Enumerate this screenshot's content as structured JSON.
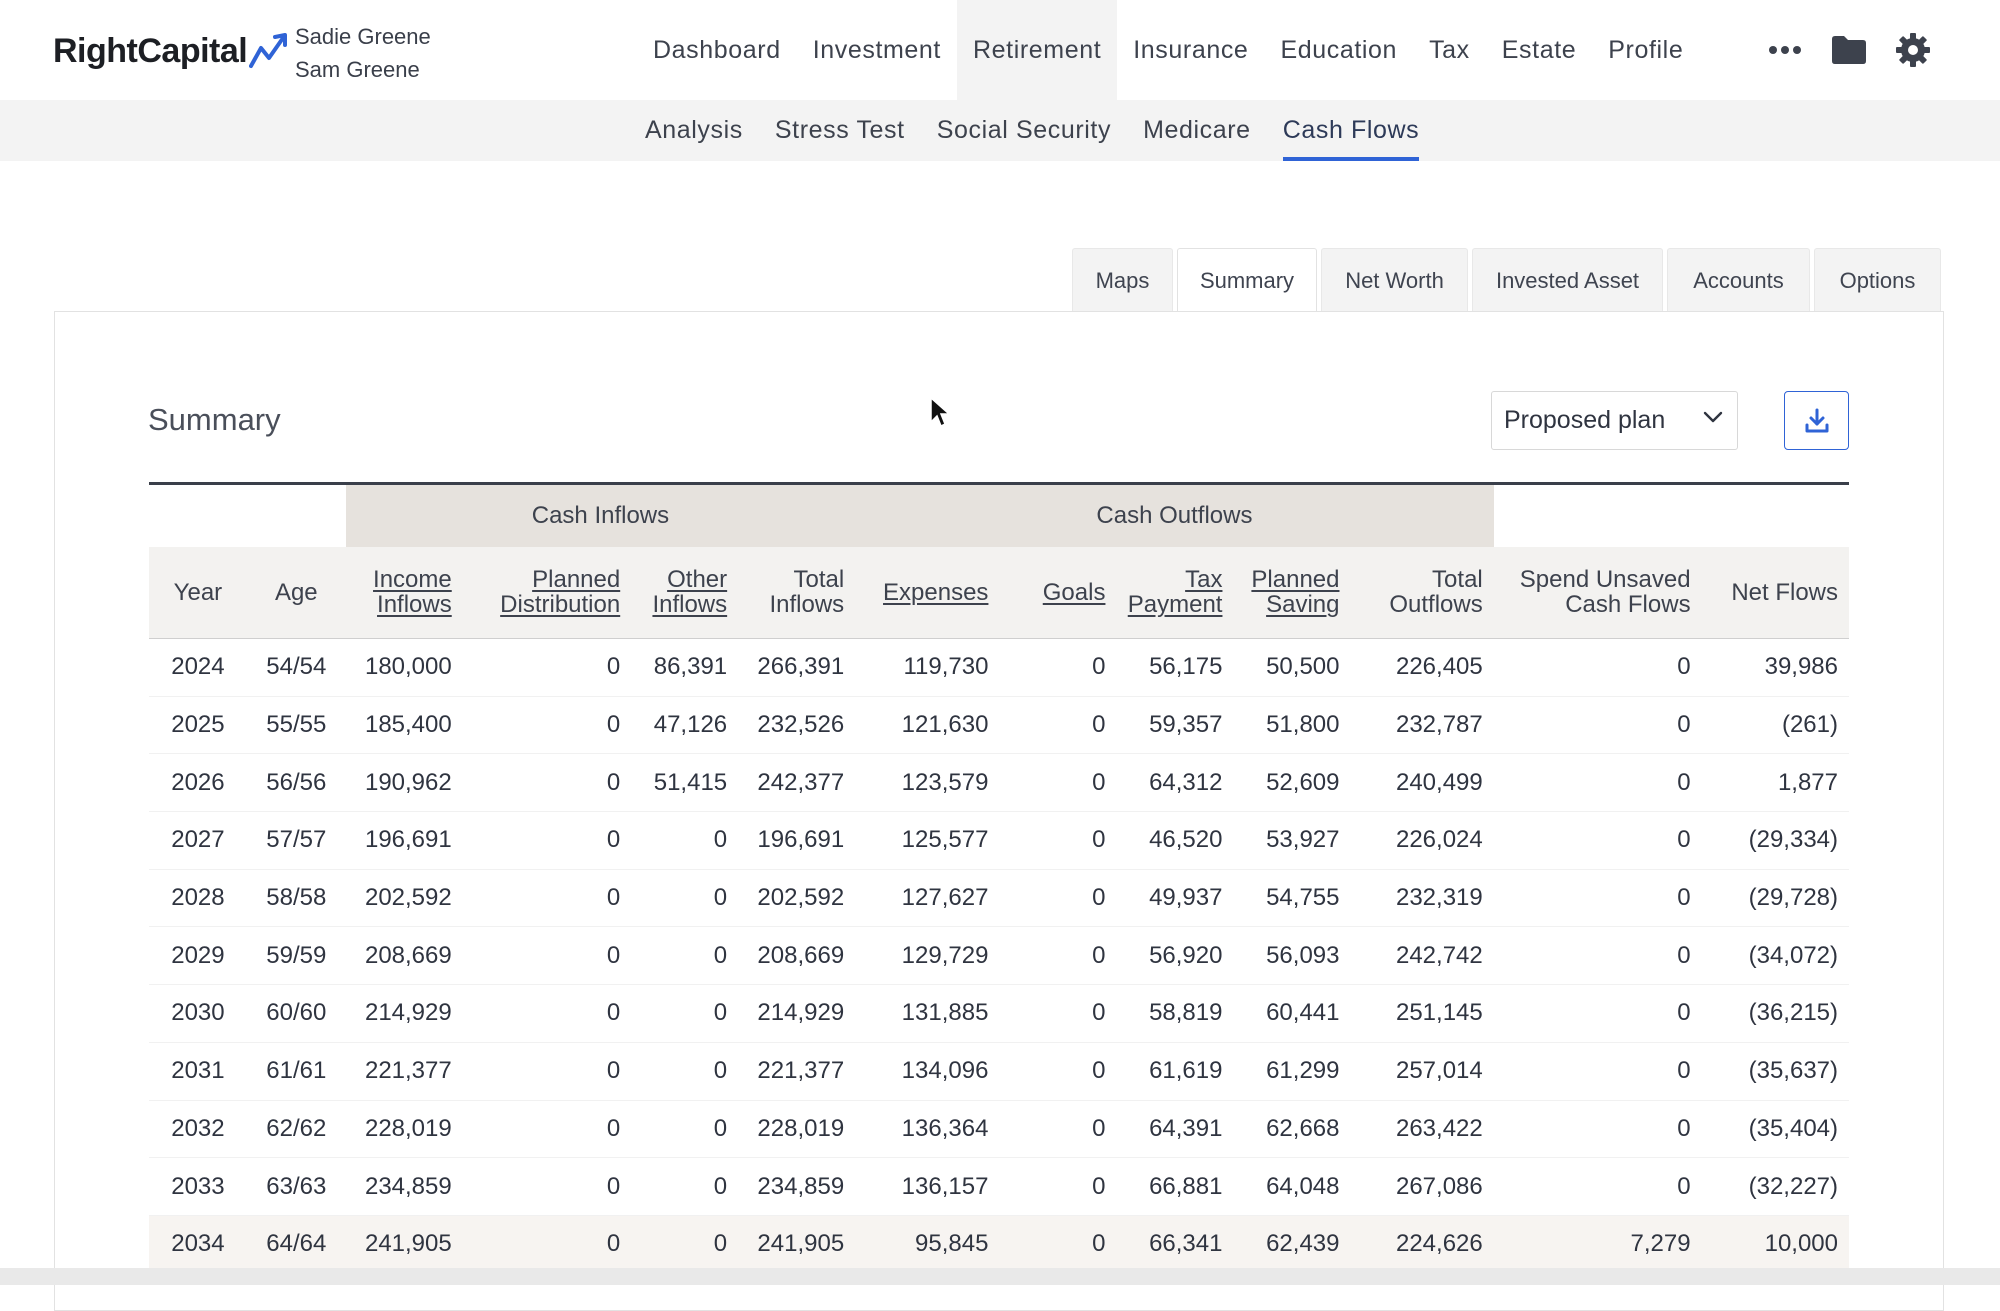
{
  "brand": {
    "name": "RightCapital",
    "accent": "#2f63d6"
  },
  "clients": [
    "Sadie Greene",
    "Sam Greene"
  ],
  "main_nav": [
    "Dashboard",
    "Investment",
    "Retirement",
    "Insurance",
    "Education",
    "Tax",
    "Estate",
    "Profile"
  ],
  "main_nav_active": "Retirement",
  "icons": {
    "more": "more-dots-icon",
    "folder": "folder-icon",
    "settings": "gear-icon"
  },
  "sub_nav": [
    "Analysis",
    "Stress Test",
    "Social Security",
    "Medicare",
    "Cash Flows"
  ],
  "sub_nav_active": "Cash Flows",
  "tabs": [
    "Maps",
    "Summary",
    "Net Worth",
    "Invested Asset",
    "Accounts",
    "Options"
  ],
  "tab_active": "Summary",
  "summary": {
    "title": "Summary",
    "plan_select": "Proposed plan",
    "download_icon": "download-icon"
  },
  "table": {
    "groups": {
      "inflows": "Cash Inflows",
      "outflows": "Cash Outflows"
    },
    "columns": [
      "Year",
      "Age",
      "Income Inflows",
      "Planned Distribution",
      "Other Inflows",
      "Total Inflows",
      "Expenses",
      "Goals",
      "Tax Payment",
      "Planned Saving",
      "Total Outflows",
      "Spend Unsaved Cash Flows",
      "Net Flows"
    ],
    "rows": [
      [
        "2024",
        "54/54",
        "180,000",
        "0",
        "86,391",
        "266,391",
        "119,730",
        "0",
        "56,175",
        "50,500",
        "226,405",
        "0",
        "39,986"
      ],
      [
        "2025",
        "55/55",
        "185,400",
        "0",
        "47,126",
        "232,526",
        "121,630",
        "0",
        "59,357",
        "51,800",
        "232,787",
        "0",
        "(261)"
      ],
      [
        "2026",
        "56/56",
        "190,962",
        "0",
        "51,415",
        "242,377",
        "123,579",
        "0",
        "64,312",
        "52,609",
        "240,499",
        "0",
        "1,877"
      ],
      [
        "2027",
        "57/57",
        "196,691",
        "0",
        "0",
        "196,691",
        "125,577",
        "0",
        "46,520",
        "53,927",
        "226,024",
        "0",
        "(29,334)"
      ],
      [
        "2028",
        "58/58",
        "202,592",
        "0",
        "0",
        "202,592",
        "127,627",
        "0",
        "49,937",
        "54,755",
        "232,319",
        "0",
        "(29,728)"
      ],
      [
        "2029",
        "59/59",
        "208,669",
        "0",
        "0",
        "208,669",
        "129,729",
        "0",
        "56,920",
        "56,093",
        "242,742",
        "0",
        "(34,072)"
      ],
      [
        "2030",
        "60/60",
        "214,929",
        "0",
        "0",
        "214,929",
        "131,885",
        "0",
        "58,819",
        "60,441",
        "251,145",
        "0",
        "(36,215)"
      ],
      [
        "2031",
        "61/61",
        "221,377",
        "0",
        "0",
        "221,377",
        "134,096",
        "0",
        "61,619",
        "61,299",
        "257,014",
        "0",
        "(35,637)"
      ],
      [
        "2032",
        "62/62",
        "228,019",
        "0",
        "0",
        "228,019",
        "136,364",
        "0",
        "64,391",
        "62,668",
        "263,422",
        "0",
        "(35,404)"
      ],
      [
        "2033",
        "63/63",
        "234,859",
        "0",
        "0",
        "234,859",
        "136,157",
        "0",
        "66,881",
        "64,048",
        "267,086",
        "0",
        "(32,227)"
      ],
      [
        "2034",
        "64/64",
        "241,905",
        "0",
        "0",
        "241,905",
        "95,845",
        "0",
        "66,341",
        "62,439",
        "224,626",
        "7,279",
        "10,000"
      ]
    ]
  }
}
